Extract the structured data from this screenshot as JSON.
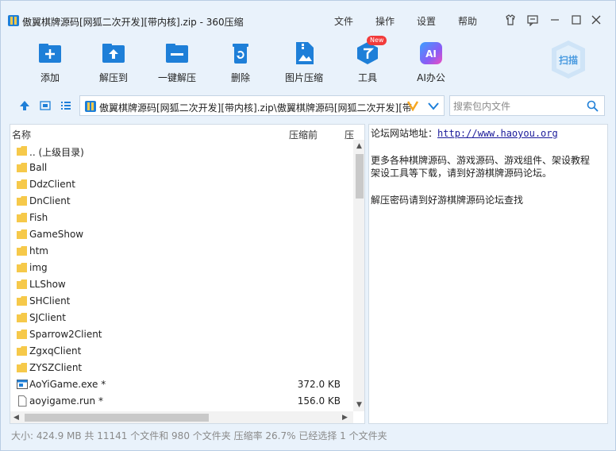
{
  "window": {
    "title": "傲翼棋牌源码[网狐二次开发][带内核].zip - 360压缩",
    "menu": [
      "文件",
      "操作",
      "设置",
      "帮助"
    ]
  },
  "toolbar": {
    "add_label": "添加",
    "extract_to_label": "解压到",
    "one_click_extract_label": "一键解压",
    "delete_label": "删除",
    "image_compress_label": "图片压缩",
    "tools_label": "工具",
    "tools_badge": "New",
    "ai_office_label": "AI办公",
    "ai_icon_text": "AI",
    "scan_label": "扫描"
  },
  "address": {
    "path": "傲翼棋牌源码[网狐二次开发][带内核].zip\\傲翼棋牌源码[网狐二次开发][带",
    "search_placeholder": "搜索包内文件"
  },
  "file_list": {
    "col_name": "名称",
    "col_compressed_before": "压缩前",
    "col_compressed_after": "压",
    "rows": [
      {
        "name": ".. (上级目录)",
        "size": "",
        "type": "folder"
      },
      {
        "name": "Ball",
        "size": "",
        "type": "folder"
      },
      {
        "name": "DdzClient",
        "size": "",
        "type": "folder"
      },
      {
        "name": "DnClient",
        "size": "",
        "type": "folder"
      },
      {
        "name": "Fish",
        "size": "",
        "type": "folder"
      },
      {
        "name": "GameShow",
        "size": "",
        "type": "folder"
      },
      {
        "name": "htm",
        "size": "",
        "type": "folder"
      },
      {
        "name": "img",
        "size": "",
        "type": "folder"
      },
      {
        "name": "LLShow",
        "size": "",
        "type": "folder"
      },
      {
        "name": "SHClient",
        "size": "",
        "type": "folder"
      },
      {
        "name": "SJClient",
        "size": "",
        "type": "folder"
      },
      {
        "name": "Sparrow2Client",
        "size": "",
        "type": "folder"
      },
      {
        "name": "ZgxqClient",
        "size": "",
        "type": "folder"
      },
      {
        "name": "ZYSZClient",
        "size": "",
        "type": "folder"
      },
      {
        "name": "AoYiGame.exe *",
        "size": "372.0 KB",
        "type": "exe"
      },
      {
        "name": "aoyigame.run *",
        "size": "156.0 KB",
        "type": "file"
      }
    ]
  },
  "comment": {
    "forum_label": "论坛网站地址：",
    "forum_url": "http://www.haoyou.org",
    "line2": "更多各种棋牌源码、游戏源码、游戏组件、架设教程",
    "line3": "架设工具等下载，请到好游棋牌源码论坛。",
    "line4": "解压密码请到好游棋牌源码论坛查找"
  },
  "status": {
    "text": "大小: 424.9 MB 共 11141 个文件和 980 个文件夹 压缩率 26.7% 已经选择 1 个文件夹"
  },
  "colors": {
    "accent_blue": "#1e7fd8",
    "window_bg": "#e9f2fb",
    "folder": "#f6c94a",
    "badge_red": "#f23b3b"
  }
}
